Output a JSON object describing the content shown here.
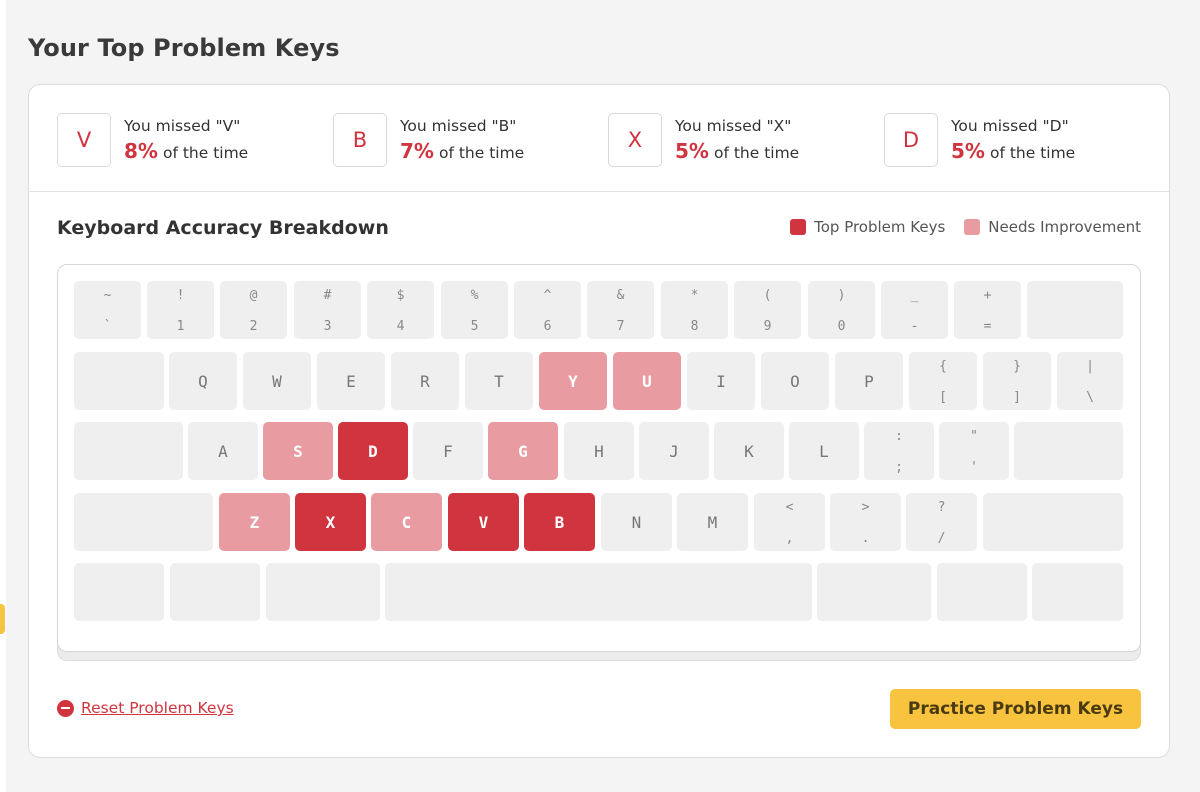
{
  "page_title": "Your Top Problem Keys",
  "problem_keys": [
    {
      "key": "V",
      "missed_text": "You missed \"V\"",
      "percent": "8%",
      "suffix": "of the time"
    },
    {
      "key": "B",
      "missed_text": "You missed \"B\"",
      "percent": "7%",
      "suffix": "of the time"
    },
    {
      "key": "X",
      "missed_text": "You missed \"X\"",
      "percent": "5%",
      "suffix": "of the time"
    },
    {
      "key": "D",
      "missed_text": "You missed \"D\"",
      "percent": "5%",
      "suffix": "of the time"
    }
  ],
  "breakdown": {
    "title": "Keyboard Accuracy Breakdown",
    "legend": {
      "top_label": "Top Problem Keys",
      "needs_label": "Needs Improvement"
    }
  },
  "colors": {
    "top_problem": "#d0343e",
    "needs_improvement": "#e89ca2",
    "normal_key": "#efefef",
    "accent_button": "#f8c440"
  },
  "keyboard": {
    "rows": [
      [
        {
          "name": "backtick",
          "top": "~",
          "bottom": "`"
        },
        {
          "name": "1",
          "top": "!",
          "bottom": "1"
        },
        {
          "name": "2",
          "top": "@",
          "bottom": "2"
        },
        {
          "name": "3",
          "top": "#",
          "bottom": "3"
        },
        {
          "name": "4",
          "top": "$",
          "bottom": "4"
        },
        {
          "name": "5",
          "top": "%",
          "bottom": "5"
        },
        {
          "name": "6",
          "top": "^",
          "bottom": "6"
        },
        {
          "name": "7",
          "top": "&",
          "bottom": "7"
        },
        {
          "name": "8",
          "top": "*",
          "bottom": "8"
        },
        {
          "name": "9",
          "top": "(",
          "bottom": "9"
        },
        {
          "name": "0",
          "top": ")",
          "bottom": "0"
        },
        {
          "name": "minus",
          "top": "_",
          "bottom": "-"
        },
        {
          "name": "equals",
          "top": "+",
          "bottom": "="
        },
        {
          "name": "backspace"
        }
      ],
      [
        {
          "name": "tab"
        },
        {
          "name": "q",
          "label": "Q"
        },
        {
          "name": "w",
          "label": "W"
        },
        {
          "name": "e",
          "label": "E"
        },
        {
          "name": "r",
          "label": "R"
        },
        {
          "name": "t",
          "label": "T"
        },
        {
          "name": "y",
          "label": "Y",
          "state": "needs"
        },
        {
          "name": "u",
          "label": "U",
          "state": "needs"
        },
        {
          "name": "i",
          "label": "I"
        },
        {
          "name": "o",
          "label": "O"
        },
        {
          "name": "p",
          "label": "P"
        },
        {
          "name": "left-bracket",
          "top": "{",
          "bottom": "["
        },
        {
          "name": "right-bracket",
          "top": "}",
          "bottom": "]"
        },
        {
          "name": "backslash",
          "top": "|",
          "bottom": "\\"
        }
      ],
      [
        {
          "name": "caps"
        },
        {
          "name": "a",
          "label": "A"
        },
        {
          "name": "s",
          "label": "S",
          "state": "needs"
        },
        {
          "name": "d",
          "label": "D",
          "state": "top"
        },
        {
          "name": "f",
          "label": "F"
        },
        {
          "name": "g",
          "label": "G",
          "state": "needs"
        },
        {
          "name": "h",
          "label": "H"
        },
        {
          "name": "j",
          "label": "J"
        },
        {
          "name": "k",
          "label": "K"
        },
        {
          "name": "l",
          "label": "L"
        },
        {
          "name": "semicolon",
          "top": ":",
          "bottom": ";"
        },
        {
          "name": "quote",
          "top": "\"",
          "bottom": "'"
        },
        {
          "name": "enter"
        }
      ],
      [
        {
          "name": "left-shift"
        },
        {
          "name": "z",
          "label": "Z",
          "state": "needs"
        },
        {
          "name": "x",
          "label": "X",
          "state": "top"
        },
        {
          "name": "c",
          "label": "C",
          "state": "needs"
        },
        {
          "name": "v",
          "label": "V",
          "state": "top"
        },
        {
          "name": "b",
          "label": "B",
          "state": "top"
        },
        {
          "name": "n",
          "label": "N"
        },
        {
          "name": "m",
          "label": "M"
        },
        {
          "name": "comma",
          "top": "<",
          "bottom": ","
        },
        {
          "name": "period",
          "top": ">",
          "bottom": "."
        },
        {
          "name": "slash",
          "top": "?",
          "bottom": "/"
        },
        {
          "name": "right-shift"
        }
      ],
      [
        {
          "name": "ctrl"
        },
        {
          "name": "alt"
        },
        {
          "name": "cmd"
        },
        {
          "name": "space"
        },
        {
          "name": "right-cmd"
        },
        {
          "name": "right-alt"
        },
        {
          "name": "right-ctrl"
        }
      ]
    ]
  },
  "actions": {
    "reset_label": "Reset Problem Keys",
    "practice_label": "Practice Problem Keys"
  }
}
